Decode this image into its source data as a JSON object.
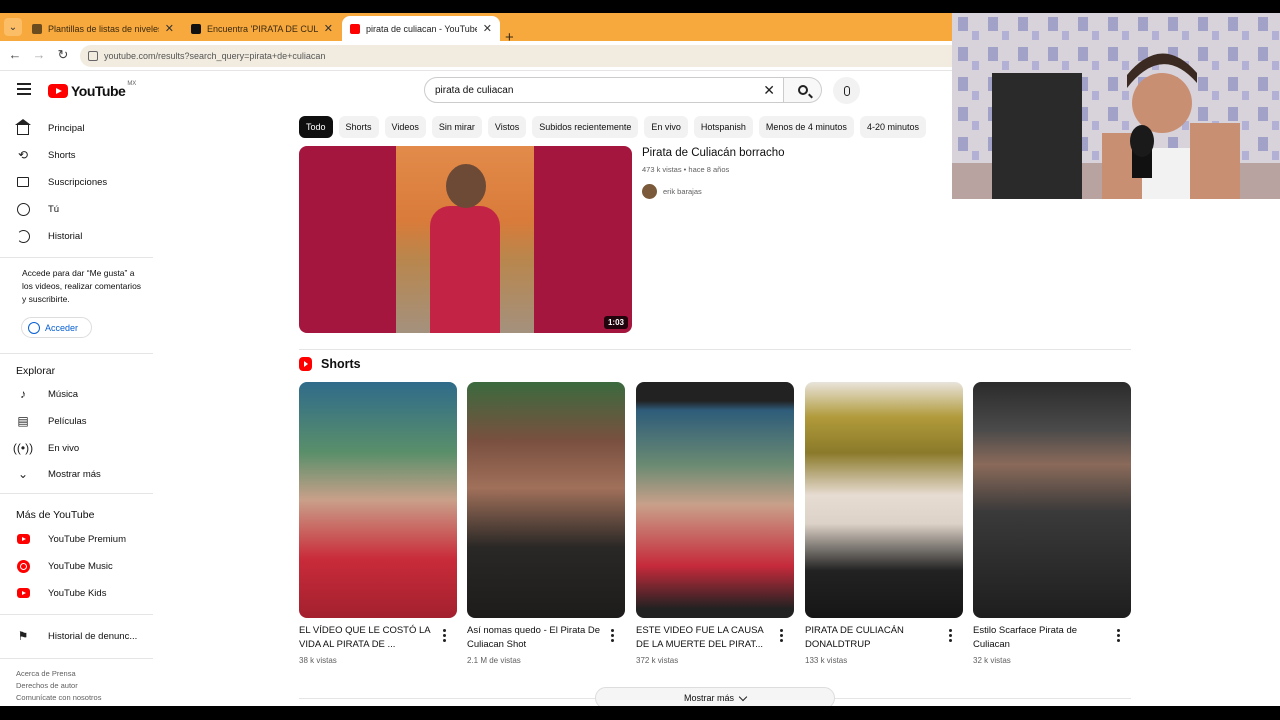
{
  "browser": {
    "tabs": [
      {
        "title": "Plantillas de listas de niveles de",
        "active": false
      },
      {
        "title": "Encuentra 'PIRATA DE CULIACA",
        "active": false
      },
      {
        "title": "pirata de culiacan - YouTube",
        "active": true
      }
    ],
    "new_tab": "+",
    "url": "youtube.com/results?search_query=pirata+de+culiacan"
  },
  "header": {
    "logo_text": "YouTube",
    "region": "MX",
    "search_value": "pirata de culiacan"
  },
  "sidebar": {
    "main_items": [
      {
        "label": "Principal",
        "icon": "home-icon"
      },
      {
        "label": "Shorts",
        "icon": "shorts-icon"
      },
      {
        "label": "Suscripciones",
        "icon": "subscriptions-icon"
      },
      {
        "label": "Tú",
        "icon": "user-icon"
      },
      {
        "label": "Historial",
        "icon": "history-icon"
      }
    ],
    "signin_note": "Accede para dar “Me gusta” a los videos, realizar comentarios y suscribirte.",
    "signin_label": "Acceder",
    "explore_heading": "Explorar",
    "explore_items": [
      {
        "label": "Música",
        "icon": "music-icon"
      },
      {
        "label": "Películas",
        "icon": "movies-icon"
      },
      {
        "label": "En vivo",
        "icon": "live-icon"
      },
      {
        "label": "Mostrar más",
        "icon": "chevron-down-icon"
      }
    ],
    "more_heading": "Más de YouTube",
    "more_items": [
      {
        "label": "YouTube Premium",
        "icon": "youtube-premium-icon"
      },
      {
        "label": "YouTube Music",
        "icon": "youtube-music-icon"
      },
      {
        "label": "YouTube Kids",
        "icon": "youtube-kids-icon"
      }
    ],
    "report_item": {
      "label": "Historial de denunc...",
      "icon": "flag-icon"
    },
    "footer_line1": "Acerca de  Prensa",
    "footer_line2": "Derechos de autor",
    "footer_line3": "Comunícate con nosotros"
  },
  "chips": [
    "Todo",
    "Shorts",
    "Videos",
    "Sin mirar",
    "Vistos",
    "Subidos recientemente",
    "En vivo",
    "Hotspanish",
    "Menos de 4 minutos",
    "4-20 minutos"
  ],
  "result": {
    "title": "Pirata de Culiacán borracho",
    "meta": "473 k vistas • hace 8 años",
    "channel": "erik barajas",
    "duration": "1:03"
  },
  "shorts": {
    "heading": "Shorts",
    "items": [
      {
        "title": "EL VÍDEO QUE LE COSTÓ LA VIDA AL PIRATA DE ...",
        "views": "38 k vistas",
        "bg": "#5a8f6a"
      },
      {
        "title": "Así nomas quedo - El Pirata De Culiacan Shot",
        "views": "2.1 M de vistas",
        "bg": "#3d3a36"
      },
      {
        "title": "ESTE VIDEO FUE LA CAUSA DE LA MUERTE DEL PIRAT...",
        "views": "372 k vistas",
        "bg": "#6a8a72"
      },
      {
        "title": "PIRATA DE CULIACÁN DONALDTRUP",
        "views": "133 k vistas",
        "bg": "#e9e4dc"
      },
      {
        "title": "Estilo Scarface Pirata de Culiacan",
        "views": "32 k vistas",
        "bg": "#4a4a4a"
      }
    ]
  },
  "more_button": "Mostrar más"
}
